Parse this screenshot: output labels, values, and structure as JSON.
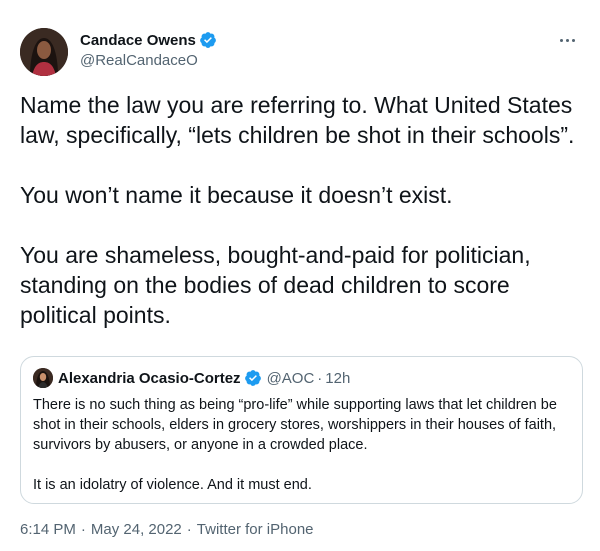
{
  "tweet": {
    "author": {
      "display_name": "Candace Owens",
      "handle": "@RealCandaceO",
      "verified": true
    },
    "paragraphs": [
      "Name the law you are referring to. What United States law, specifically, “lets children be shot in their schools”.",
      "You won’t name it because it doesn’t exist.",
      "You are shameless, bought-and-paid for politician, standing on the bodies of dead children to score political points."
    ],
    "quote": {
      "display_name": "Alexandria Ocasio-Cortez",
      "handle": "@AOC",
      "separator": "·",
      "time": "12h",
      "paragraphs": [
        "There is no such thing as being “pro-life” while supporting laws that let children be shot in their schools, elders in grocery stores, worshippers in their houses of faith, survivors by abusers, or anyone in a crowded place.",
        "It is an idolatry of violence. And it must end."
      ]
    },
    "time": "6:14 PM",
    "date": "May 24, 2022",
    "source": "Twitter for iPhone",
    "separator": "·"
  },
  "colors": {
    "verified": "#1d9bf0",
    "text": "#0f1419",
    "secondary": "#536471",
    "border": "#cfd9de"
  },
  "icons": {
    "verified": "verified-badge-icon",
    "more": "more-options-icon"
  }
}
